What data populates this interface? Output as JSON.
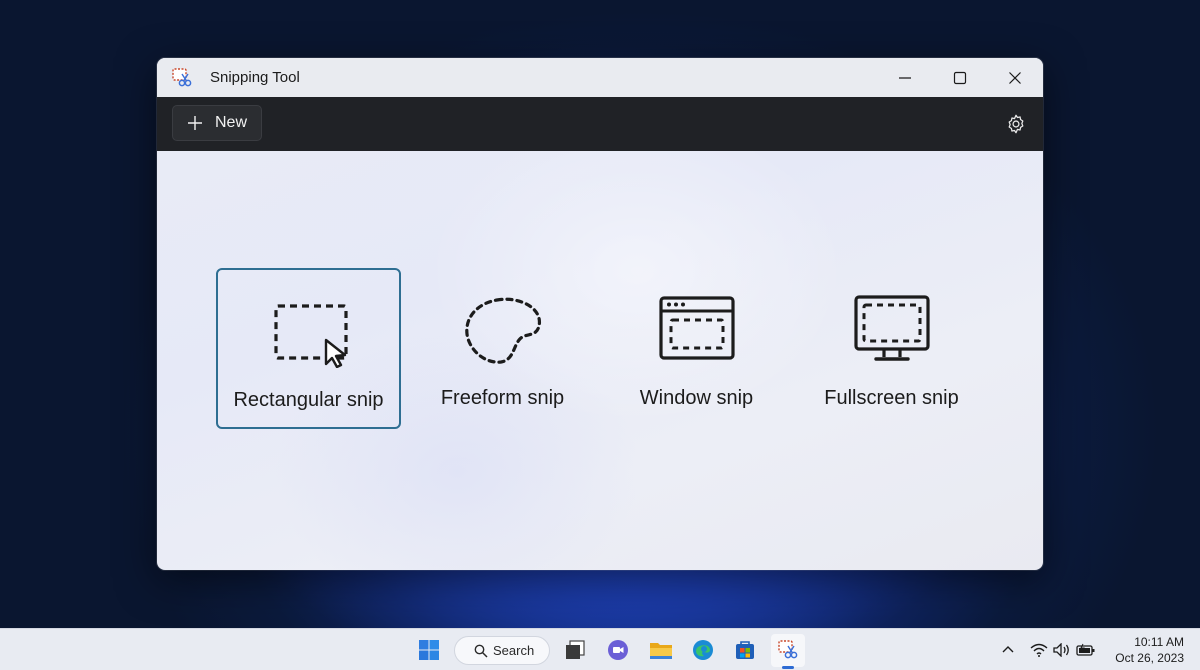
{
  "window": {
    "title": "Snipping Tool",
    "app_icon": "snipping-tool-icon"
  },
  "toolbar": {
    "new_label": "New",
    "new_icon": "plus-icon",
    "settings_icon": "gear-icon"
  },
  "modes": [
    {
      "label": "Rectangular snip",
      "icon": "rectangular-snip-icon",
      "selected": true
    },
    {
      "label": "Freeform snip",
      "icon": "freeform-snip-icon",
      "selected": false
    },
    {
      "label": "Window snip",
      "icon": "window-snip-icon",
      "selected": false
    },
    {
      "label": "Fullscreen snip",
      "icon": "fullscreen-snip-icon",
      "selected": false
    }
  ],
  "taskbar": {
    "search_label": "Search",
    "pinned": [
      "start-icon",
      "search",
      "task-view-icon",
      "chat-icon",
      "file-explorer-icon",
      "edge-icon",
      "store-icon",
      "snipping-tool-icon"
    ],
    "active": "snipping-tool-icon"
  },
  "tray": {
    "time": "10:11 AM",
    "date": "Oct 26, 2023"
  },
  "colors": {
    "accent": "#2e6e92",
    "toolbar_bg": "#202226",
    "taskbar_indicator": "#2d6bd3"
  }
}
